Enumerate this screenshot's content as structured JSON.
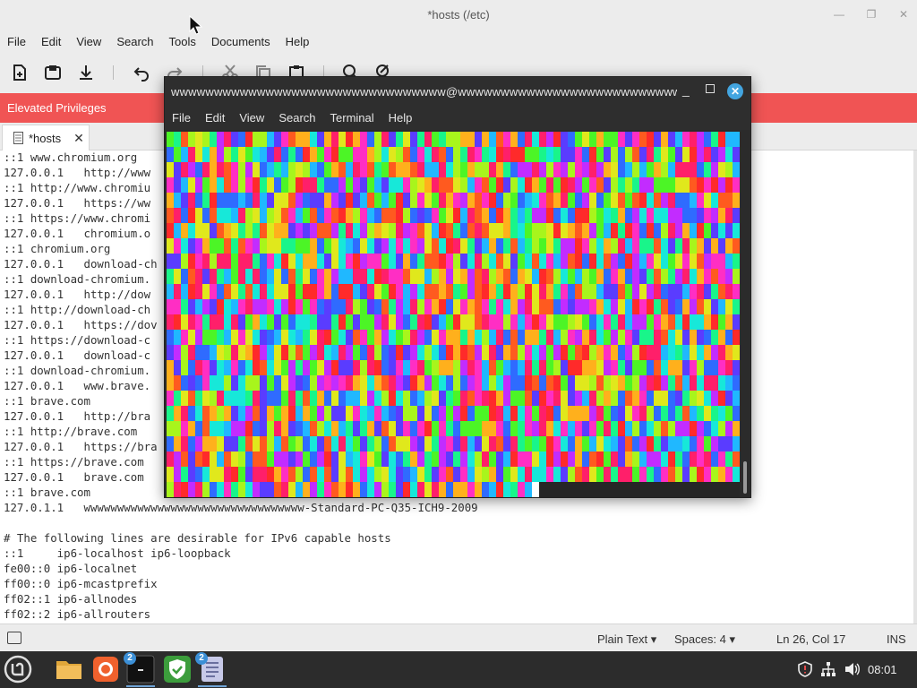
{
  "editor": {
    "title": "*hosts (/etc)",
    "menu": [
      "File",
      "Edit",
      "View",
      "Search",
      "Tools",
      "Documents",
      "Help"
    ],
    "toolbar_icons": [
      "new-document-icon",
      "save-icon",
      "download-icon",
      "undo-icon",
      "redo-icon",
      "cut-icon",
      "copy-icon",
      "paste-icon",
      "find-icon",
      "replace-icon"
    ],
    "elevated_label": "Elevated Privileges",
    "tab_label": "*hosts",
    "lines": [
      "::1 www.chromium.org",
      "127.0.0.1   http://www",
      "::1 http://www.chromiu",
      "127.0.0.1   https://ww",
      "::1 https://www.chromi",
      "127.0.0.1   chromium.o",
      "::1 chromium.org",
      "127.0.0.1   download-ch",
      "::1 download-chromium.",
      "127.0.0.1   http://dow",
      "::1 http://download-ch",
      "127.0.0.1   https://dov",
      "::1 https://download-c",
      "127.0.0.1   download-c",
      "::1 download-chromium.",
      "127.0.0.1   www.brave.",
      "::1 brave.com",
      "127.0.0.1   http://bra",
      "::1 http://brave.com",
      "127.0.0.1   https://bra",
      "::1 https://brave.com",
      "127.0.0.1   brave.com",
      "::1 brave.com",
      "127.0.1.1   wwwwwwwwwwwwwwwwwwwwwwwwwwwwwwwww-Standard-PC-Q35-ICH9-2009",
      "",
      "# The following lines are desirable for IPv6 capable hosts",
      "::1     ip6-localhost ip6-loopback",
      "fe00::0 ip6-localnet",
      "ff00::0 ip6-mcastprefix",
      "ff02::1 ip6-allnodes",
      "ff02::2 ip6-allrouters"
    ],
    "status": {
      "language": "Plain Text",
      "spaces": "Spaces: 4",
      "position": "Ln 26, Col 17",
      "mode": "INS"
    }
  },
  "terminal": {
    "title": "wwwwwwwwwwwwwwwwwwwwwwwwwwwwwwww@wwwwwwwwwwwwwwwwwwwwwwwwwwwwwwww: ~",
    "menu": [
      "File",
      "Edit",
      "View",
      "Search",
      "Terminal",
      "Help"
    ]
  },
  "taskbar": {
    "items": [
      {
        "name": "files-app",
        "badge": ""
      },
      {
        "name": "firefox-app",
        "badge": ""
      },
      {
        "name": "terminal-app",
        "badge": "2"
      },
      {
        "name": "update-manager-app",
        "badge": ""
      },
      {
        "name": "text-editor-app",
        "badge": "2"
      }
    ],
    "clock": "08:01"
  }
}
